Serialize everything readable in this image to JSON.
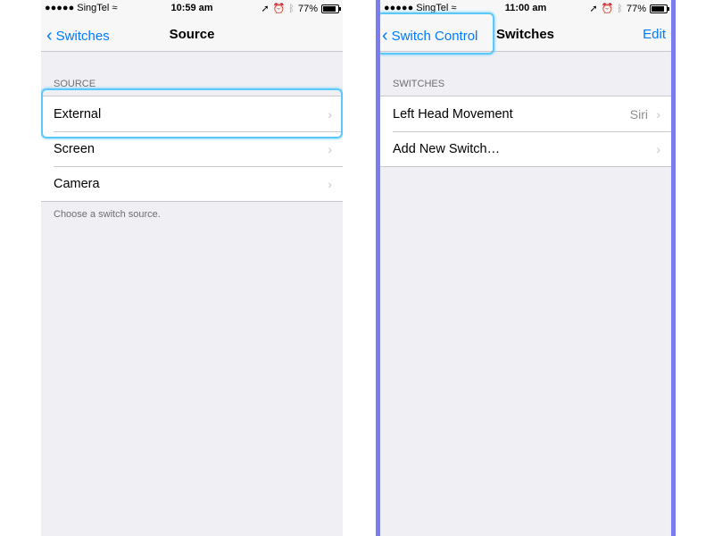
{
  "left": {
    "status": {
      "carrier": "●●●●● SingTel",
      "wifi_icon": "wifi-icon",
      "time": "10:59 am",
      "battery": "77%",
      "battery_level": 0.77
    },
    "nav": {
      "back": "Switches",
      "title": "Source"
    },
    "section_header": "SOURCE",
    "rows": [
      {
        "label": "External"
      },
      {
        "label": "Screen"
      },
      {
        "label": "Camera"
      }
    ],
    "footer": "Choose a switch source."
  },
  "right": {
    "status": {
      "carrier": "●●●●● SingTel",
      "wifi_icon": "wifi-icon",
      "time": "11:00 am",
      "battery": "77%",
      "battery_level": 0.77
    },
    "nav": {
      "back": "Switch Control",
      "title": "Switches",
      "edit": "Edit"
    },
    "section_header": "SWITCHES",
    "rows": [
      {
        "label": "Left Head Movement",
        "detail": "Siri"
      },
      {
        "label": "Add New Switch…",
        "detail": ""
      }
    ]
  },
  "colors": {
    "accent": "#007aff",
    "highlight": "#5ac8fa",
    "border": "#7b7bf2"
  }
}
